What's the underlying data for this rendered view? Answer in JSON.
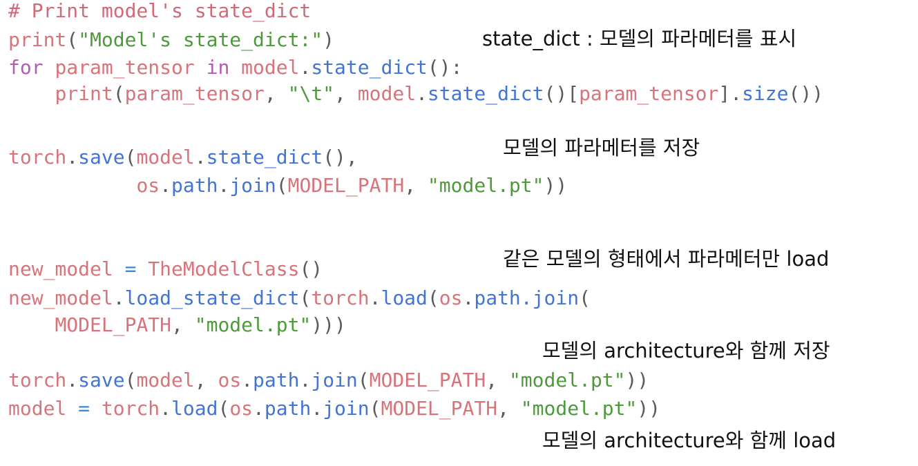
{
  "code_lines": [
    [
      {
        "t": "# Print model's state_dict",
        "c": "cmt"
      }
    ],
    [
      {
        "t": "print",
        "c": "var"
      },
      {
        "t": "(",
        "c": "pun"
      },
      {
        "t": "\"Model's state_dict:\"",
        "c": "str"
      },
      {
        "t": ")",
        "c": "pun"
      }
    ],
    [
      {
        "t": "for",
        "c": "kw"
      },
      {
        "t": " ",
        "c": "pun"
      },
      {
        "t": "param_tensor",
        "c": "var"
      },
      {
        "t": " ",
        "c": "pun"
      },
      {
        "t": "in",
        "c": "kw"
      },
      {
        "t": " ",
        "c": "pun"
      },
      {
        "t": "model",
        "c": "var"
      },
      {
        "t": ".",
        "c": "pun"
      },
      {
        "t": "state_dict",
        "c": "fn"
      },
      {
        "t": "():",
        "c": "pun"
      }
    ],
    [
      {
        "t": "    ",
        "c": "pun"
      },
      {
        "t": "print",
        "c": "var"
      },
      {
        "t": "(",
        "c": "pun"
      },
      {
        "t": "param_tensor",
        "c": "var"
      },
      {
        "t": ", ",
        "c": "pun"
      },
      {
        "t": "\"\\t\"",
        "c": "str"
      },
      {
        "t": ", ",
        "c": "pun"
      },
      {
        "t": "model",
        "c": "var"
      },
      {
        "t": ".",
        "c": "pun"
      },
      {
        "t": "state_dict",
        "c": "fn"
      },
      {
        "t": "()[",
        "c": "pun"
      },
      {
        "t": "param_tensor",
        "c": "var"
      },
      {
        "t": "].",
        "c": "pun"
      },
      {
        "t": "size",
        "c": "fn"
      },
      {
        "t": "())",
        "c": "pun"
      }
    ],
    [
      {
        "t": "torch",
        "c": "var"
      },
      {
        "t": ".",
        "c": "pun"
      },
      {
        "t": "save",
        "c": "fn"
      },
      {
        "t": "(",
        "c": "pun"
      },
      {
        "t": "model",
        "c": "var"
      },
      {
        "t": ".",
        "c": "pun"
      },
      {
        "t": "state_dict",
        "c": "fn"
      },
      {
        "t": "(),",
        "c": "pun"
      }
    ],
    [
      {
        "t": "           ",
        "c": "pun"
      },
      {
        "t": "os",
        "c": "var"
      },
      {
        "t": ".",
        "c": "pun"
      },
      {
        "t": "path",
        "c": "fn"
      },
      {
        "t": ".",
        "c": "pun"
      },
      {
        "t": "join",
        "c": "fn"
      },
      {
        "t": "(",
        "c": "pun"
      },
      {
        "t": "MODEL_PATH",
        "c": "var"
      },
      {
        "t": ", ",
        "c": "pun"
      },
      {
        "t": "\"model.pt\"",
        "c": "str"
      },
      {
        "t": "))",
        "c": "pun"
      }
    ],
    [
      {
        "t": "new_model",
        "c": "var"
      },
      {
        "t": " = ",
        "c": "op"
      },
      {
        "t": "TheModelClass",
        "c": "var"
      },
      {
        "t": "()",
        "c": "pun"
      }
    ],
    [
      {
        "t": "new_model",
        "c": "var"
      },
      {
        "t": ".",
        "c": "pun"
      },
      {
        "t": "load_state_dict",
        "c": "fn"
      },
      {
        "t": "(",
        "c": "pun"
      },
      {
        "t": "torch",
        "c": "var"
      },
      {
        "t": ".",
        "c": "pun"
      },
      {
        "t": "load",
        "c": "fn"
      },
      {
        "t": "(",
        "c": "pun"
      },
      {
        "t": "os",
        "c": "var"
      },
      {
        "t": ".",
        "c": "pun"
      },
      {
        "t": "path.join",
        "c": "fn"
      },
      {
        "t": "(",
        "c": "pun"
      }
    ],
    [
      {
        "t": "    ",
        "c": "pun"
      },
      {
        "t": "MODEL_PATH",
        "c": "var"
      },
      {
        "t": ", ",
        "c": "pun"
      },
      {
        "t": "\"model.pt\"",
        "c": "str"
      },
      {
        "t": ")))",
        "c": "pun"
      }
    ],
    [
      {
        "t": "torch",
        "c": "var"
      },
      {
        "t": ".",
        "c": "pun"
      },
      {
        "t": "save",
        "c": "fn"
      },
      {
        "t": "(",
        "c": "pun"
      },
      {
        "t": "model",
        "c": "var"
      },
      {
        "t": ", ",
        "c": "pun"
      },
      {
        "t": "os",
        "c": "var"
      },
      {
        "t": ".",
        "c": "pun"
      },
      {
        "t": "path",
        "c": "fn"
      },
      {
        "t": ".",
        "c": "pun"
      },
      {
        "t": "join",
        "c": "fn"
      },
      {
        "t": "(",
        "c": "pun"
      },
      {
        "t": "MODEL_PATH",
        "c": "var"
      },
      {
        "t": ", ",
        "c": "pun"
      },
      {
        "t": "\"model.pt\"",
        "c": "str"
      },
      {
        "t": "))",
        "c": "pun"
      }
    ],
    [
      {
        "t": "model",
        "c": "var"
      },
      {
        "t": " = ",
        "c": "op"
      },
      {
        "t": "torch",
        "c": "var"
      },
      {
        "t": ".",
        "c": "pun"
      },
      {
        "t": "load",
        "c": "fn"
      },
      {
        "t": "(",
        "c": "pun"
      },
      {
        "t": "os",
        "c": "var"
      },
      {
        "t": ".",
        "c": "pun"
      },
      {
        "t": "path",
        "c": "fn"
      },
      {
        "t": ".",
        "c": "pun"
      },
      {
        "t": "join",
        "c": "fn"
      },
      {
        "t": "(",
        "c": "pun"
      },
      {
        "t": "MODEL_PATH",
        "c": "var"
      },
      {
        "t": ", ",
        "c": "pun"
      },
      {
        "t": "\"model.pt\"",
        "c": "str"
      },
      {
        "t": "))",
        "c": "pun"
      }
    ]
  ],
  "annotations": {
    "state_dict_display": "state_dict : 모델의 파라메터를 표시",
    "save_params": "모델의 파라메터를 저장",
    "load_params": "같은 모델의 형태에서 파라메터만 load",
    "save_with_arch": "모델의 architecture와 함께 저장",
    "load_with_arch": "모델의 architecture와 함께 load"
  },
  "colors": {
    "comment": "#d16a78",
    "keyword": "#b45ab7",
    "identifier": "#d8737a",
    "function": "#4274d4",
    "string": "#4c9a3a",
    "operator": "#3a88d8",
    "punctuation": "#5a5a5a"
  }
}
